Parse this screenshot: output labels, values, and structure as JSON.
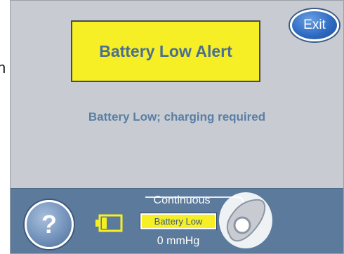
{
  "edge_text": "n",
  "alert": {
    "title": "Battery Low Alert"
  },
  "message": "Battery Low; charging required",
  "exit_button": {
    "label": "Exit"
  },
  "help_button": {
    "glyph": "?"
  },
  "status": {
    "mode": "Continuous",
    "battery_badge": "Battery Low",
    "pressure": "0 mmHg"
  },
  "icons": {
    "battery": "battery-low-icon",
    "pump": "pump-device-icon",
    "help": "help-question-icon"
  },
  "colors": {
    "alert_background": "#f6ef25",
    "alert_text": "#4a6e94",
    "screen_background": "#c8ccd2",
    "bottom_bar": "#5b7a9c",
    "exit_button": "#2f6cc4"
  }
}
